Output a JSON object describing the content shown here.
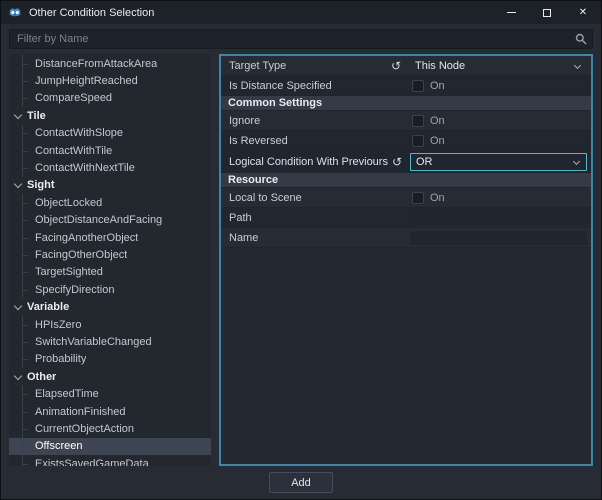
{
  "window": {
    "title": "Other Condition Selection",
    "controls": {
      "close": "✕"
    }
  },
  "icons": {
    "revert": "↺"
  },
  "filter": {
    "placeholder": "Filter by Name"
  },
  "tree": {
    "items": [
      {
        "label": "DistanceFromAttackArea",
        "type": "item"
      },
      {
        "label": "JumpHeightReached",
        "type": "item"
      },
      {
        "label": "CompareSpeed",
        "type": "item"
      },
      {
        "label": "Tile",
        "type": "category"
      },
      {
        "label": "ContactWithSlope",
        "type": "item"
      },
      {
        "label": "ContactWithTile",
        "type": "item"
      },
      {
        "label": "ContactWithNextTile",
        "type": "item"
      },
      {
        "label": "Sight",
        "type": "category"
      },
      {
        "label": "ObjectLocked",
        "type": "item"
      },
      {
        "label": "ObjectDistanceAndFacing",
        "type": "item"
      },
      {
        "label": "FacingAnotherObject",
        "type": "item"
      },
      {
        "label": "FacingOtherObject",
        "type": "item"
      },
      {
        "label": "TargetSighted",
        "type": "item"
      },
      {
        "label": "SpecifyDirection",
        "type": "item"
      },
      {
        "label": "Variable",
        "type": "category"
      },
      {
        "label": "HPIsZero",
        "type": "item"
      },
      {
        "label": "SwitchVariableChanged",
        "type": "item"
      },
      {
        "label": "Probability",
        "type": "item"
      },
      {
        "label": "Other",
        "type": "category"
      },
      {
        "label": "ElapsedTime",
        "type": "item"
      },
      {
        "label": "AnimationFinished",
        "type": "item"
      },
      {
        "label": "CurrentObjectAction",
        "type": "item"
      },
      {
        "label": "Offscreen",
        "type": "item",
        "selected": true
      },
      {
        "label": "ExistsSavedGameData",
        "type": "item"
      }
    ]
  },
  "inspector": {
    "rows": [
      {
        "kind": "property",
        "label": "Target Type",
        "revert": true,
        "control": "dropdown",
        "value": "This Node"
      },
      {
        "kind": "property",
        "label": "Is Distance Specified",
        "control": "checkbox",
        "value": "On",
        "checked": false
      },
      {
        "kind": "section",
        "label": "Common Settings"
      },
      {
        "kind": "property",
        "label": "Ignore",
        "control": "checkbox",
        "value": "On",
        "checked": false
      },
      {
        "kind": "property",
        "label": "Is Reversed",
        "control": "checkbox",
        "value": "On",
        "checked": false
      },
      {
        "kind": "property",
        "label": "Logical Condition With Previours",
        "revert": true,
        "control": "dropdown",
        "value": "OR",
        "focused": true
      },
      {
        "kind": "section",
        "label": "Resource"
      },
      {
        "kind": "property",
        "label": "Local to Scene",
        "control": "checkbox",
        "value": "On",
        "checked": false
      },
      {
        "kind": "property",
        "label": "Path",
        "control": "text",
        "value": ""
      },
      {
        "kind": "property",
        "label": "Name",
        "control": "text",
        "value": ""
      }
    ]
  },
  "footer": {
    "add_label": "Add"
  },
  "colors": {
    "panel_border": "#4084a8",
    "focus_border": "#56b9ca",
    "selection": "#3e4552",
    "titlebar": "#1d2128",
    "background": "#262b34"
  }
}
